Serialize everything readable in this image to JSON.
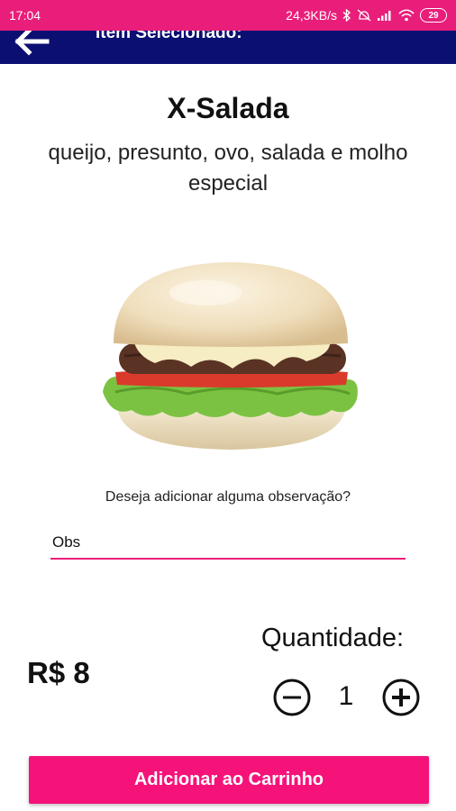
{
  "status_bar": {
    "time": "17:04",
    "network_speed": "24,3KB/s",
    "battery_level": "29",
    "icons": [
      "bluetooth-icon",
      "dnd-icon",
      "signal-icon",
      "wifi-icon",
      "battery-icon"
    ]
  },
  "app_bar": {
    "title": "Item Selecionado:",
    "background": "#0b0f72"
  },
  "item": {
    "name": "X-Salada",
    "description": "queijo, presunto, ovo, salada e molho especial",
    "image": "burger-image"
  },
  "observation": {
    "question": "Deseja adicionar alguma observação?",
    "value": "Obs"
  },
  "price": "R$ 8",
  "quantity": {
    "label": "Quantidade:",
    "value": "1"
  },
  "add_button": {
    "label": "Adicionar ao Carrinho"
  },
  "colors": {
    "accent": "#e91e7a",
    "button": "#f5137a",
    "navy": "#0b0f72"
  }
}
